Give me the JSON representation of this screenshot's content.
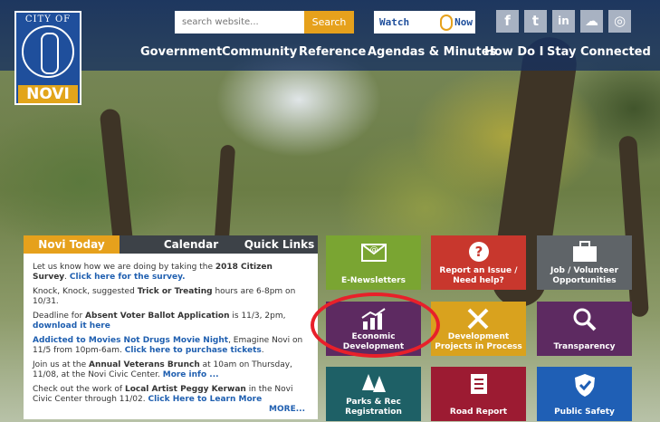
{
  "logo": {
    "top_text": "CITY OF",
    "bottom_text": "NOVI"
  },
  "search": {
    "placeholder": "search website...",
    "button_label": "Search"
  },
  "watch_banner": {
    "left": "Watch",
    "right": "Now"
  },
  "social": [
    {
      "icon": "facebook-icon",
      "glyph": "f"
    },
    {
      "icon": "twitter-icon",
      "glyph": "t"
    },
    {
      "icon": "linkedin-icon",
      "glyph": "in"
    },
    {
      "icon": "chat-icon",
      "glyph": "☁"
    },
    {
      "icon": "instagram-icon",
      "glyph": "◎"
    }
  ],
  "nav": [
    "Government",
    "Community",
    "Reference",
    "Agendas & Minutes",
    "How Do I",
    "Stay Connected"
  ],
  "tabs": {
    "active": "Novi Today",
    "second": "Calendar",
    "third": "Quick Links"
  },
  "news": {
    "item1": {
      "a": "Let us know how we are doing by taking the ",
      "b": "2018 Citizen Survey",
      "c": ".",
      "link": "Click here for the survey."
    },
    "item2": {
      "a": "Knock, Knock, suggested ",
      "b": "Trick or Treating",
      "c": " hours are 6-8pm on 10/31."
    },
    "item3": {
      "a": "Deadline for ",
      "b": "Absent Voter Ballot Application",
      "c": " is 11/3, 2pm, ",
      "link": "download it here"
    },
    "item4": {
      "link1": "Addicted to Movies Not Drugs Movie Night",
      "a": ", Emagine Novi on 11/5 from 10pm-6am.  ",
      "link2": "Click here to purchase tickets",
      "c": "."
    },
    "item5": {
      "a": "Join us at the ",
      "b": "Annual Veterans Brunch",
      "c": " at 10am on Thursday, 11/08, at the Novi Civic Center. ",
      "link": "More info ..."
    },
    "item6": {
      "a": "Check out the work of ",
      "b": "Local Artist Peggy Kerwan",
      "c": " in the Novi Civic Center through 11/02.  ",
      "link": "Click Here to Learn More"
    },
    "more": "MORE..."
  },
  "tiles": {
    "enews": "E-Newsletters",
    "report": "Report an Issue / Need help?",
    "job": "Job / Volunteer Opportunities",
    "econ": "Economic Development",
    "devproj": "Development Projects in Process",
    "transparency": "Transparency",
    "parks": "Parks & Rec Registration",
    "road": "Road Report",
    "safety": "Public Safety"
  },
  "colors": {
    "header_blue": "#16305f",
    "accent_gold": "#e6a11c",
    "tab_dark": "#3d4248",
    "tile_green": "#7aa532",
    "tile_red": "#c8372d",
    "tile_gray": "#5f6468",
    "tile_purple": "#5d2a61",
    "tile_gold": "#d9a21e",
    "tile_teal": "#1e6066",
    "tile_maroon": "#9c1b32",
    "tile_blue": "#1f5fb5",
    "highlight_red": "#e8202a"
  }
}
